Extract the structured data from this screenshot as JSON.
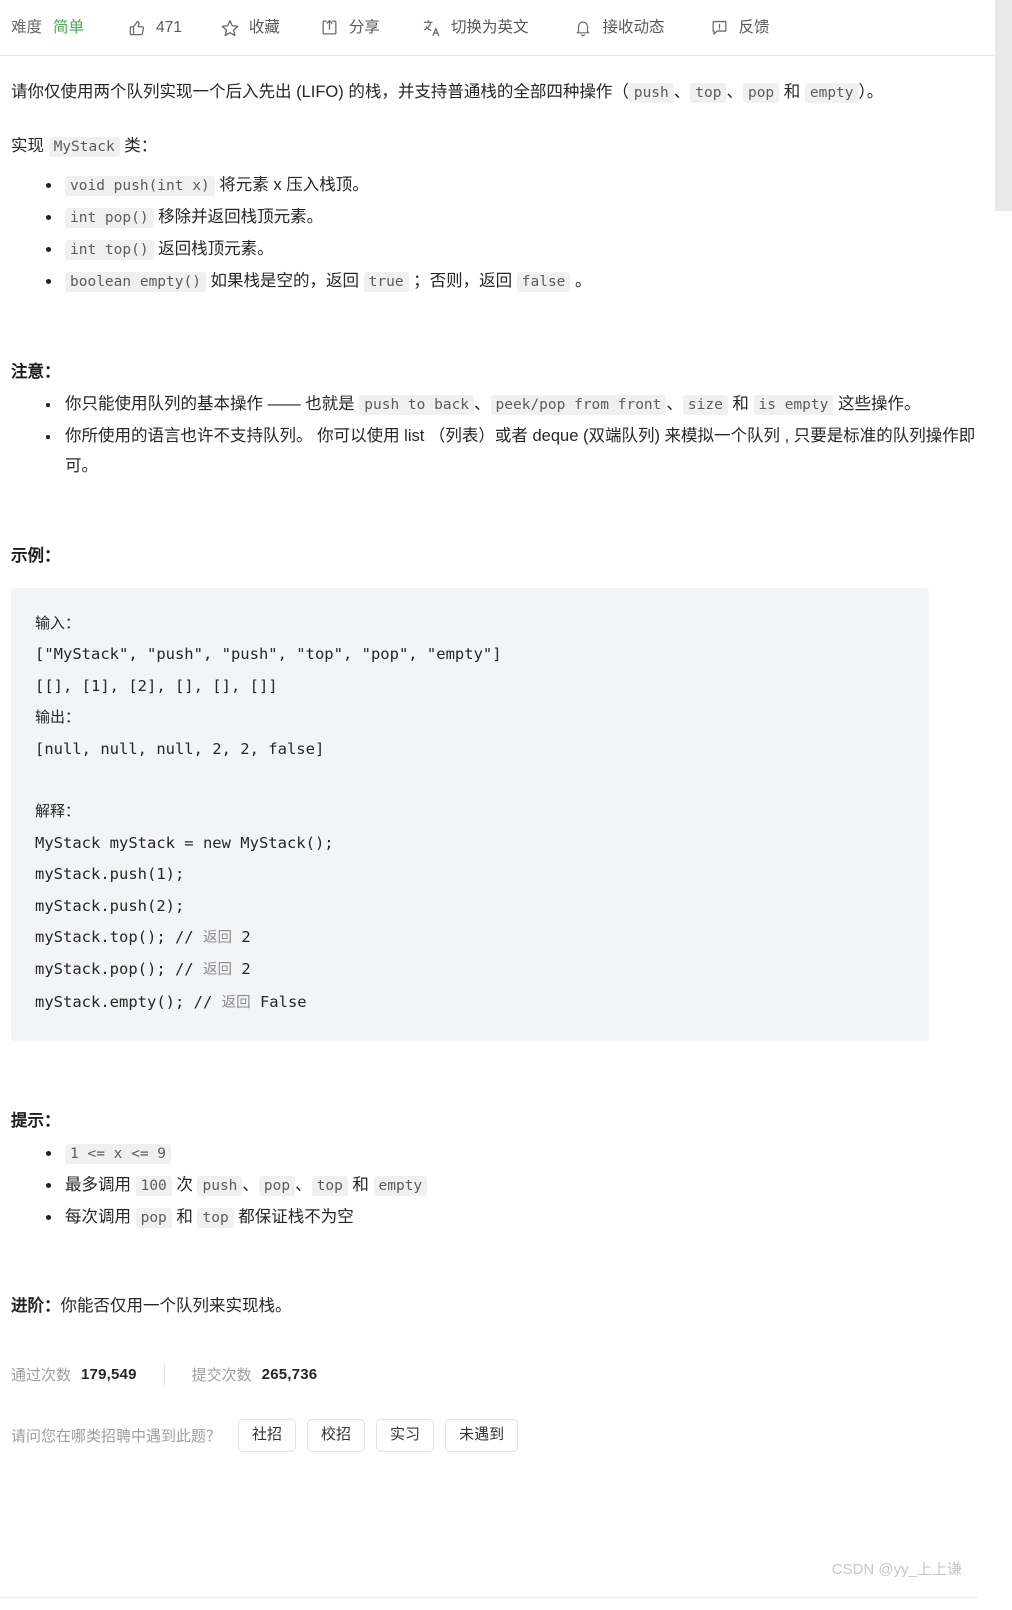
{
  "toolbar": {
    "difficulty_label": "难度",
    "difficulty_value": "简单",
    "difficulty_color": "#4caf50",
    "like_count": "471",
    "favorite_label": "收藏",
    "share_label": "分享",
    "translate_label": "切换为英文",
    "subscribe_label": "接收动态",
    "feedback_label": "反馈",
    "icons": {
      "thumbs_up": "thumbs-up-icon",
      "star": "star-icon",
      "share": "share-icon",
      "translate": "translate-icon",
      "bell": "bell-icon",
      "feedback": "feedback-icon"
    }
  },
  "description": {
    "intro_p1_a": "请你仅使用两个队列实现一个后入先出 (LIFO) 的栈，并支持普通栈的全部四种操作（",
    "intro_code_push": "push",
    "intro_sep1": "、",
    "intro_code_top": "top",
    "intro_sep2": "、",
    "intro_code_pop": "pop",
    "intro_and": "和",
    "intro_code_empty": "empty",
    "intro_p1_b": "）。",
    "implement_prefix": "实现",
    "implement_class": "MyStack",
    "implement_suffix": "类：",
    "methods": [
      {
        "code": "void push(int x)",
        "text": "将元素 x 压入栈顶。"
      },
      {
        "code": "int pop()",
        "text": "移除并返回栈顶元素。"
      },
      {
        "code": "int top()",
        "text": "返回栈顶元素。"
      },
      {
        "code": "boolean empty()",
        "text": "如果栈是空的，返回",
        "code2": "true",
        "text2": "；否则，返回",
        "code3": "false",
        "text3": "。"
      }
    ]
  },
  "notes": {
    "heading": "注意：",
    "item1": {
      "a": "你只能使用队列的基本操作 —— 也就是",
      "code1": "push to back",
      "sep1": "、",
      "code2": "peek/pop from front",
      "sep2": "、",
      "code3": "size",
      "and": "和",
      "code4": "is empty",
      "b": "这些操作。"
    },
    "item2": "你所使用的语言也许不支持队列。 你可以使用 list （列表）或者 deque (双端队列) 来模拟一个队列 , 只要是标准的队列操作即可。"
  },
  "example": {
    "heading": "示例：",
    "input_label": "输入：",
    "input_line1": "[\"MyStack\", \"push\", \"push\", \"top\", \"pop\", \"empty\"]",
    "input_line2": "[[], [1], [2], [], [], []]",
    "output_label": "输出：",
    "output_line": "[null, null, null, 2, 2, false]",
    "explain_label": "解释：",
    "explain_lines": [
      {
        "code": "MyStack myStack = new MyStack();",
        "comment": "",
        "ret": ""
      },
      {
        "code": "myStack.push(1);",
        "comment": "",
        "ret": ""
      },
      {
        "code": "myStack.push(2);",
        "comment": "",
        "ret": ""
      },
      {
        "code": "myStack.top(); // ",
        "comment": "返回",
        "ret": " 2"
      },
      {
        "code": "myStack.pop(); // ",
        "comment": "返回",
        "ret": " 2"
      },
      {
        "code": "myStack.empty(); // ",
        "comment": "返回",
        "ret": " False"
      }
    ]
  },
  "hints": {
    "heading": "提示：",
    "item1_code": "1 <= x <= 9",
    "item2": {
      "a": "最多调用",
      "code1": "100",
      "b": "次",
      "code2": "push",
      "sep1": "、",
      "code3": "pop",
      "sep2": "、",
      "code4": "top",
      "and": "和",
      "code5": "empty"
    },
    "item3": {
      "a": "每次调用",
      "code1": "pop",
      "and": "和",
      "code2": "top",
      "b": "都保证栈不为空"
    }
  },
  "advanced": {
    "label": "进阶：",
    "text": "你能否仅用一个队列来实现栈。"
  },
  "stats": {
    "accepted_label": "通过次数",
    "accepted_value": "179,549",
    "submitted_label": "提交次数",
    "submitted_value": "265,736"
  },
  "survey": {
    "question": "请问您在哪类招聘中遇到此题？",
    "options": [
      "社招",
      "校招",
      "实习",
      "未遇到"
    ]
  },
  "watermark": "CSDN @yy_上上谦"
}
